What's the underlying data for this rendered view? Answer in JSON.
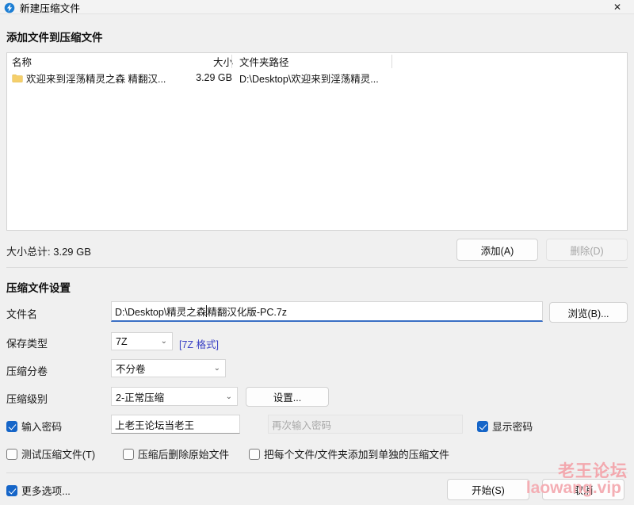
{
  "window": {
    "title": "新建压缩文件",
    "icon": "archive-app-icon",
    "close_label": "✕"
  },
  "add_files": {
    "heading": "添加文件到压缩文件",
    "columns": [
      "名称",
      "大小",
      "文件夹路径"
    ],
    "rows": [
      {
        "name": "欢迎来到淫荡精灵之森 精翻汉...",
        "size": "3.29 GB",
        "path": "D:\\Desktop\\欢迎来到淫荡精灵...",
        "icon": "folder-icon"
      }
    ],
    "total_size_label": "大小总计: 3.29 GB",
    "add_button": "添加(A)",
    "delete_button": "删除(D)"
  },
  "archive_settings": {
    "heading": "压缩文件设置",
    "filename_label": "文件名",
    "filename_value_before_caret": "D:\\Desktop\\精灵之森 ",
    "filename_value_after_caret": "精翻汉化版-PC.7z",
    "browse_button": "浏览(B)...",
    "savetype_label": "保存类型",
    "savetype_value": "7Z",
    "format_link": "[7Z 格式]",
    "volume_label": "压缩分卷",
    "volume_value": "不分卷",
    "level_label": "压缩级别",
    "level_value": "2-正常压缩",
    "settings_button": "设置...",
    "chevron": "⌄"
  },
  "options": {
    "password_checkbox": "输入密码",
    "password_checked": true,
    "password_value": "上老王论坛当老王",
    "password_confirm_placeholder": "再次输入密码",
    "password_confirm_value": "",
    "showpass_checkbox": "显示密码",
    "showpass_checked": true,
    "test_checkbox": "测试压缩文件(T)",
    "test_checked": false,
    "delete_source_checkbox": "压缩后删除原始文件",
    "delete_source_checked": false,
    "separate_archives_checkbox": "把每个文件/文件夹添加到单独的压缩文件",
    "separate_archives_checked": false,
    "more_options_checkbox": "更多选项...",
    "more_options_checked": true
  },
  "footer": {
    "start_button": "开始(S)",
    "cancel_button": "取消"
  },
  "watermark": {
    "cn": "老王论坛",
    "en": "laowang.vip",
    "color": "#f3a8ae"
  }
}
